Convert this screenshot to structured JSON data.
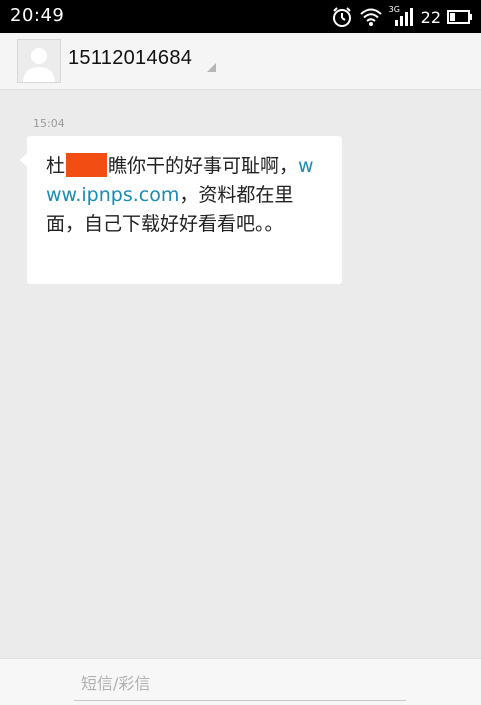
{
  "status_bar": {
    "time": "20:49",
    "network_type": "3G",
    "battery_level": "22",
    "icons": [
      "alarm-icon",
      "wifi-icon",
      "signal-icon",
      "battery-icon"
    ]
  },
  "conversation": {
    "contact_number": "15112014684"
  },
  "message": {
    "time": "15:04",
    "text_before_redaction": "杜",
    "text_after_redaction": "瞧你干的好事可耻啊，",
    "link": "www.ipnps.com",
    "text_after_link": "，资料都在里面，自己下载好好看看吧。。"
  },
  "composer": {
    "placeholder": "短信/彩信"
  },
  "colors": {
    "status_bar": "#000000",
    "background": "#ebebeb",
    "link": "#1a8bb3",
    "redaction": "#f24d12"
  }
}
